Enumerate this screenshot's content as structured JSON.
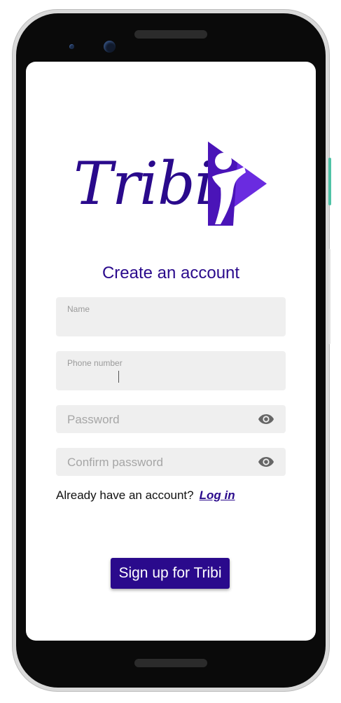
{
  "logo": {
    "text": "Tribi",
    "brand_color": "#2a0a8c",
    "accent_color": "#6a2be0"
  },
  "signup": {
    "title": "Create an account",
    "fields": {
      "name": {
        "label": "Name",
        "value": ""
      },
      "phone": {
        "label": "Phone number",
        "value": ""
      },
      "password": {
        "placeholder": "Password",
        "icon": "eye-icon"
      },
      "confirm_password": {
        "placeholder": "Confirm password",
        "icon": "eye-icon"
      }
    },
    "login_prompt": "Already have an account?",
    "login_link": "Log in",
    "submit_label": "Sign up for Tribi"
  },
  "colors": {
    "field_background": "#efefef",
    "button_background": "#2a0a8c",
    "placeholder_text": "#a6a6a6"
  }
}
